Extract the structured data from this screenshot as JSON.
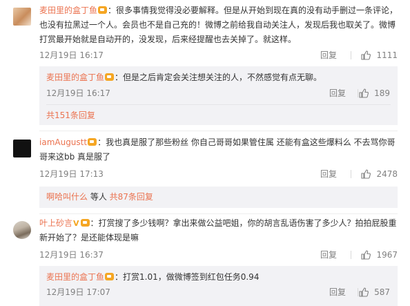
{
  "comments": [
    {
      "username": "麦田里的盒丁鱼",
      "text": "：很多事情我觉得没必要解释。但是从开始到现在真的没有动手删过一条评论，也没有拉黑过一个人。会员也不是自己充的！微博之前给我自动关注人，发现后我也取关了。微博打赏最开始就是自动开的，没发现，后来经提醒也去关掉了。就这样。",
      "time": "12月19日 16:17",
      "reply": "回复",
      "likes": "1111",
      "sub": {
        "username": "麦田里的盒丁鱼",
        "text": "：但是之后肯定会关注想关注的人，不然感觉有点无聊。",
        "time": "12月19日 16:17",
        "reply": "回复",
        "likes": "189",
        "more": "共151条回复"
      }
    },
    {
      "username": "iamAugustt",
      "text": "：我也真是服了那些粉丝  你自己哥哥如果管住属  还能有盒这些爆料么  不去骂你哥哥来这bb   真是服了",
      "time": "12月19日 17:13",
      "reply": "回复",
      "likes": "2478",
      "sub": {
        "prefix": "啊哈叫什么",
        "middle": " 等人 ",
        "more": "共87条回复"
      }
    },
    {
      "username": "叶上砂言",
      "text": "：打赏搜了多少钱啊？拿出来做公益吧姐，你的胡言乱语伤害了多少人？拍拍屁股重新开始了？是还能体现是嘛",
      "time": "12月19日 16:37",
      "reply": "回复",
      "likes": "1967",
      "sub": {
        "username": "麦田里的盒丁鱼",
        "text": "：打赏1.01，做微博签到红包任务0.94",
        "time": "12月19日 17:07",
        "reply": "回复",
        "likes": "587"
      }
    }
  ],
  "colors": {
    "accent": "#eb7350",
    "meta": "#808080",
    "subbg": "#f2f2f5"
  }
}
